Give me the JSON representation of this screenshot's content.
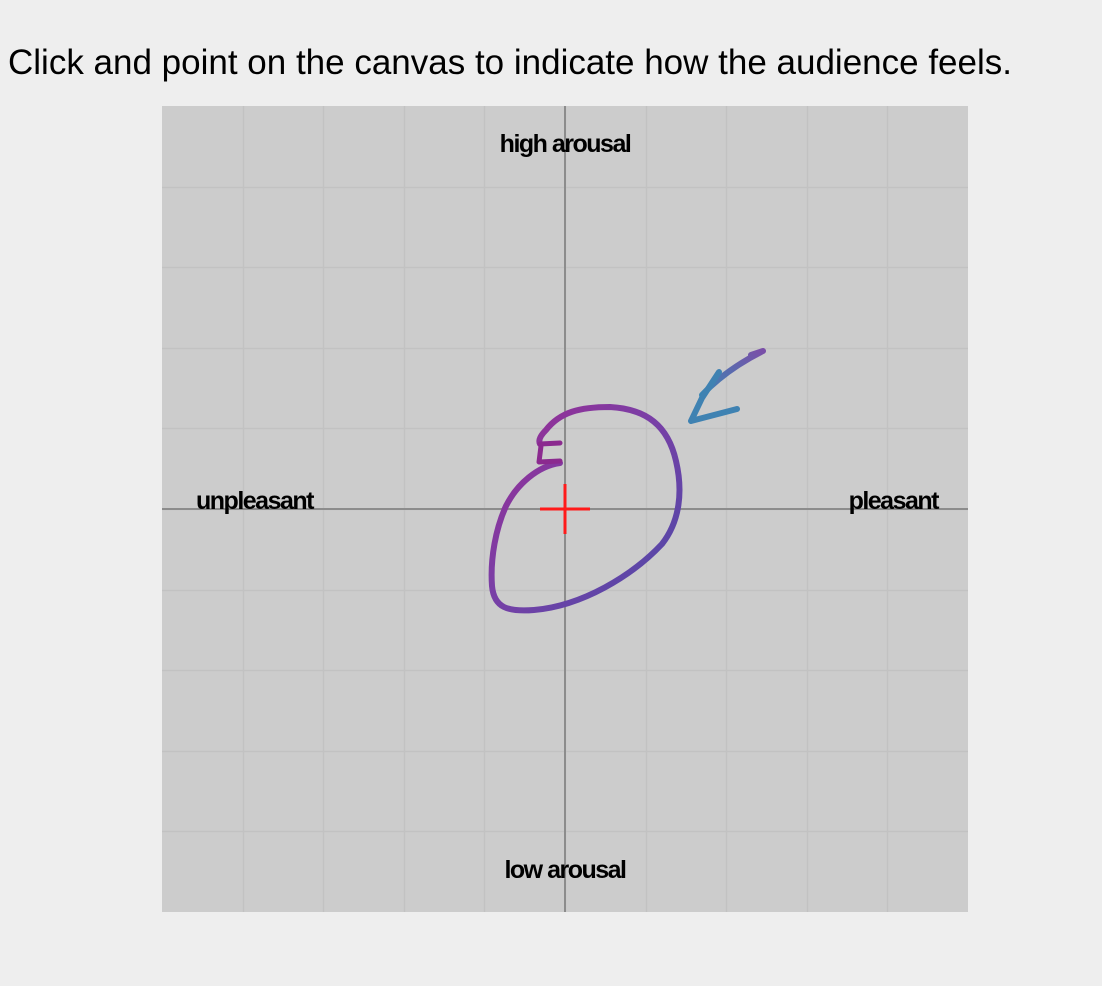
{
  "instruction": "Click and point on the canvas to indicate how the audience feels.",
  "canvas": {
    "background_color": "#cccccc",
    "grid_color": "#c2c2c2",
    "axis_color": "#8c8c8c",
    "grid_divisions": 10,
    "labels": {
      "top": "high arousal",
      "bottom": "low arousal",
      "left": "unpleasant",
      "right": "pleasant"
    },
    "marker": {
      "shape": "crosshair",
      "color": "#ff1a1a",
      "position": "center"
    },
    "annotation": {
      "shape": "hand-drawn loop with arrow pointing to marker",
      "colors": [
        "#9b2a91",
        "#7a3fa6",
        "#4b4aa8",
        "#3a86b4"
      ]
    }
  }
}
